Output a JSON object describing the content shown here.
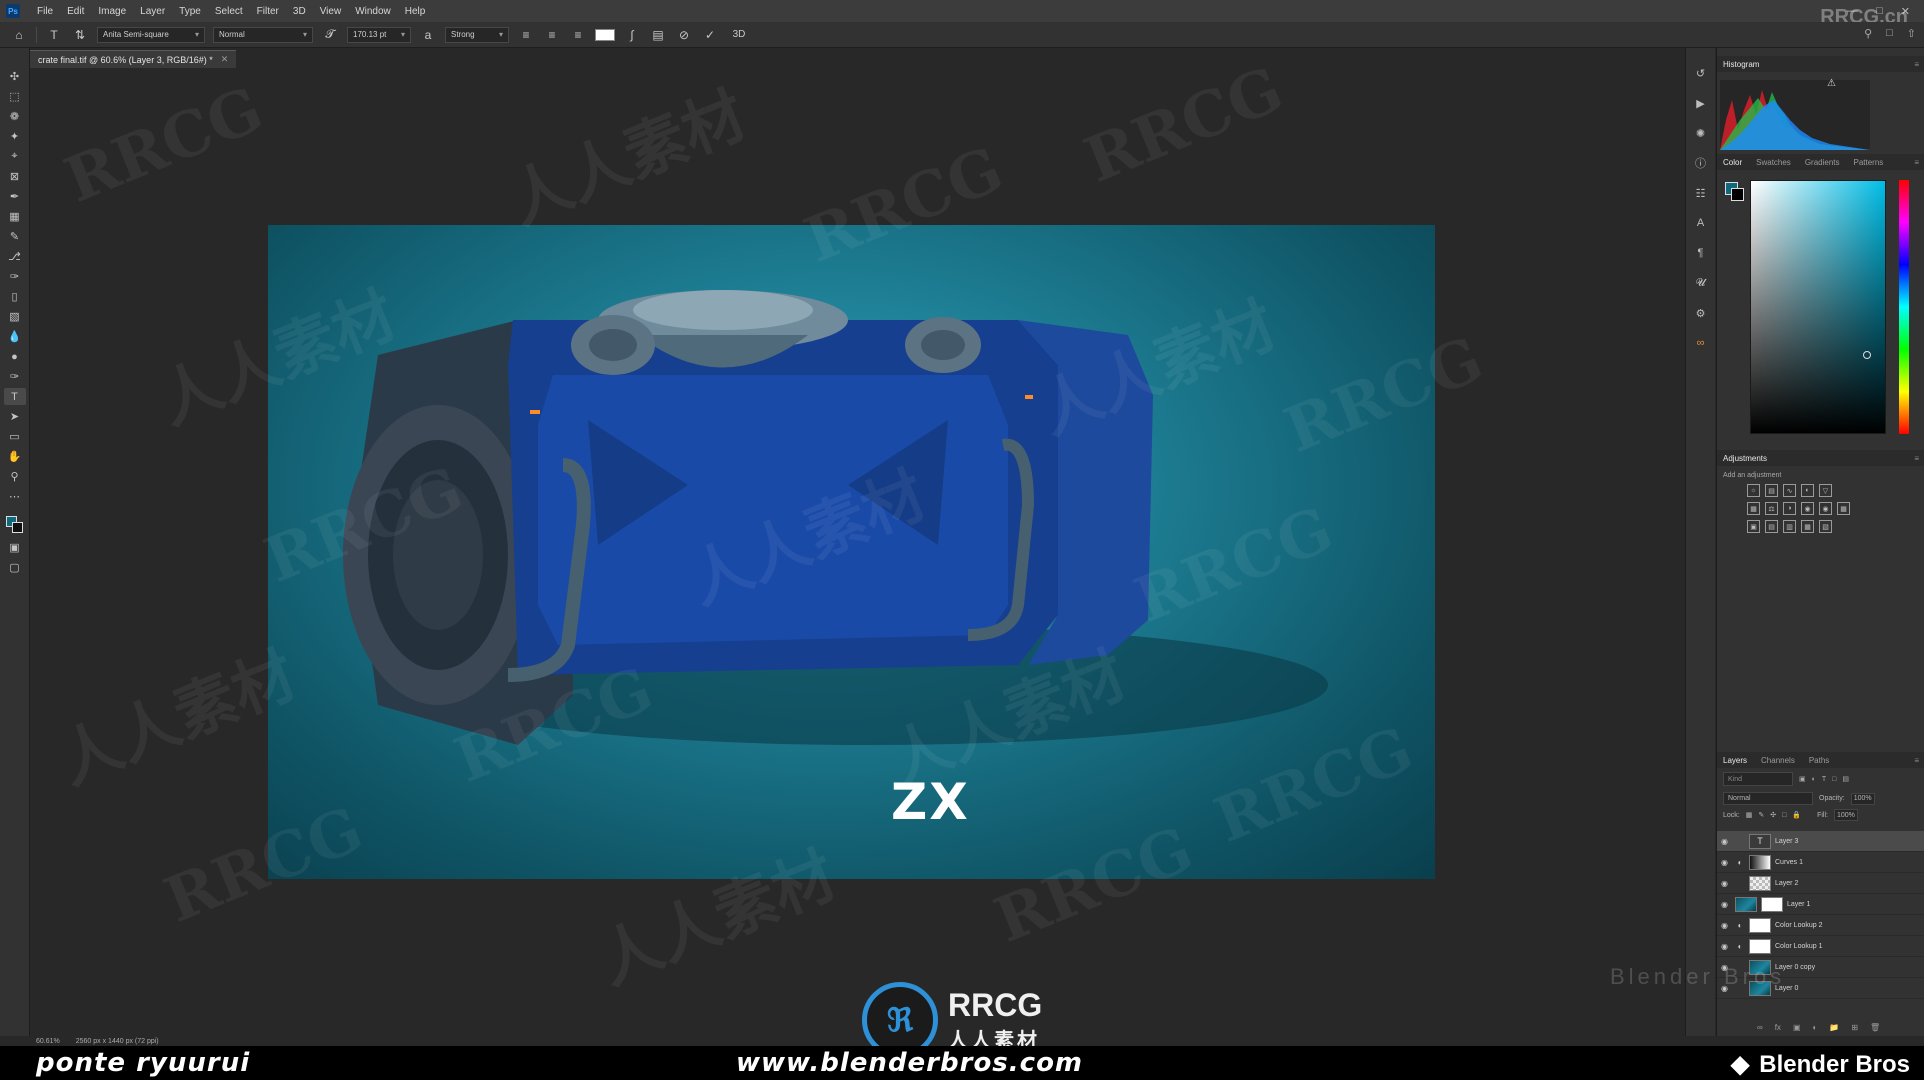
{
  "menubar": {
    "app_icon": "Ps",
    "items": [
      "File",
      "Edit",
      "Image",
      "Layer",
      "Type",
      "Select",
      "Filter",
      "3D",
      "View",
      "Window",
      "Help"
    ]
  },
  "options": {
    "font_family": "Anita Semi-square",
    "font_style": "Normal",
    "font_size": "170.13 pt",
    "antialias": "Strong",
    "three_d": "3D"
  },
  "document": {
    "tab_title": "crate final.tif @ 60.6% (Layer 3, RGB/16#) *",
    "logo_text": "ZX"
  },
  "status": {
    "zoom": "60.61%",
    "doc_size": "2560 px x 1440 px (72 ppi)"
  },
  "panels": {
    "histogram_tab": "Histogram",
    "color_tabs": [
      "Color",
      "Swatches",
      "Gradients",
      "Patterns"
    ],
    "adjustments_tab": "Adjustments",
    "add_adjustment": "Add an adjustment",
    "layers_tabs": [
      "Layers",
      "Channels",
      "Paths"
    ],
    "layers_search_placeholder": "Kind",
    "blend_mode": "Normal",
    "opacity_label": "Opacity:",
    "opacity_value": "100%",
    "lock_label": "Lock:",
    "fill_label": "Fill:",
    "fill_value": "100%",
    "layers": [
      {
        "name": "Layer 3",
        "thumb": "type"
      },
      {
        "name": "Curves 1",
        "thumb": "curves"
      },
      {
        "name": "Layer 2",
        "thumb": "checker"
      },
      {
        "name": "Layer 1",
        "thumb": "image"
      },
      {
        "name": "Color Lookup 2",
        "thumb": "adj"
      },
      {
        "name": "Color Lookup 1",
        "thumb": "adj"
      },
      {
        "name": "Layer 0 copy",
        "thumb": "image"
      },
      {
        "name": "Layer 0",
        "thumb": "image"
      }
    ]
  },
  "overlay": {
    "rrcg_corner": "RRCG.cn",
    "center_logo_text": "RRCG",
    "center_logo_sub": "人人素材",
    "blender_watermark": "Blender Bros",
    "banner_left": "ponte ryuurui",
    "banner_center": "www.blenderbros.com",
    "banner_right": "Blender Bros",
    "watermark_text_1": "RRCG",
    "watermark_text_2": "人人素材"
  },
  "colors": {
    "foreground": "#0f6a7d",
    "background": "#000000",
    "accent_blue": "#2e90d6"
  }
}
